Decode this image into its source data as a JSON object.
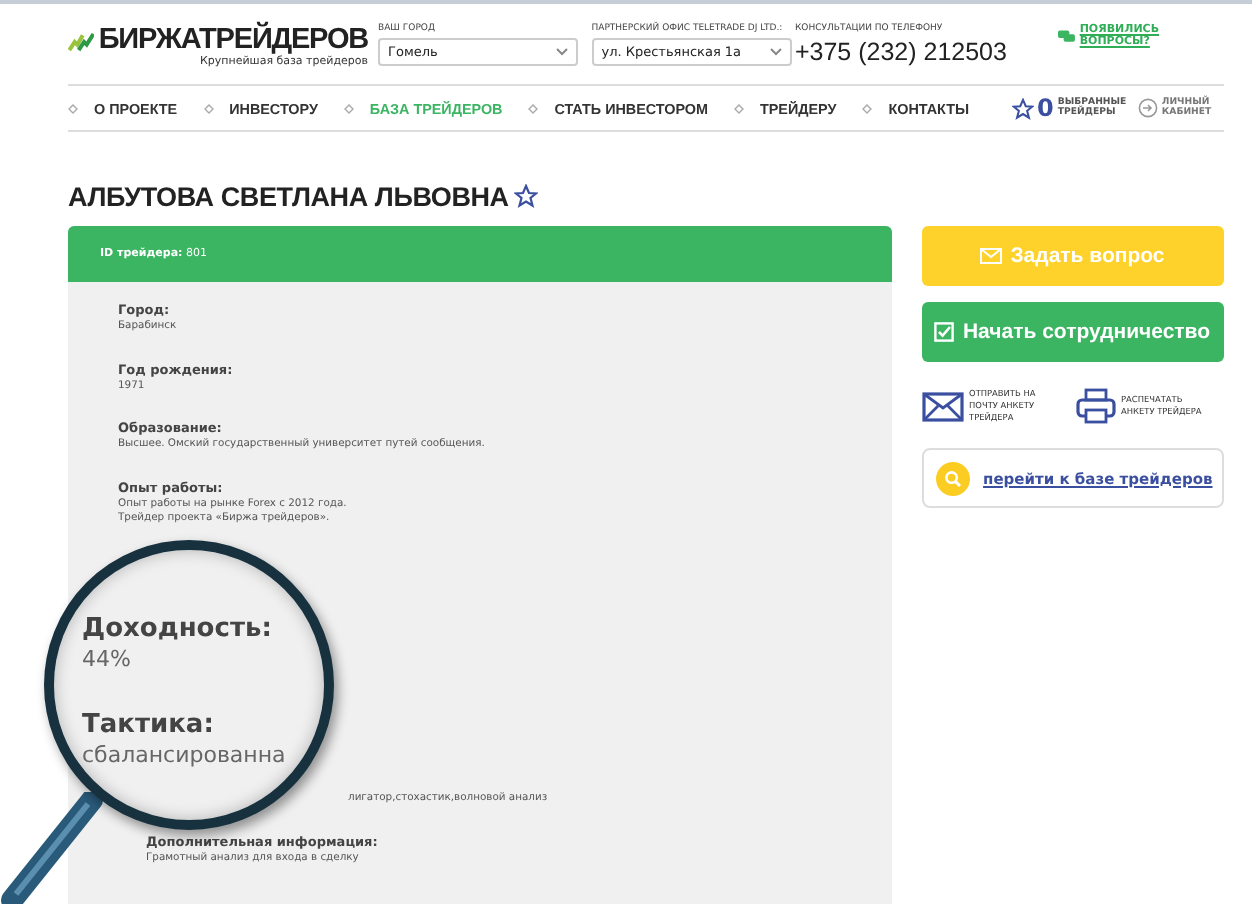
{
  "logo": {
    "title": "БИРЖАТРЕЙДЕРОВ",
    "subtitle": "Крупнейшая база трейдеров"
  },
  "selectors": [
    {
      "label": "ВАШ ГОРОД",
      "value": "Гомель"
    },
    {
      "label": "ПАРТНЕРСКИЙ ОФИС TELETRADE DJ LTD.:",
      "value": "ул. Крестьянская 1а"
    }
  ],
  "phone": {
    "label": "КОНСУЛЬТАЦИИ ПО ТЕЛЕФОНУ",
    "number": "+375 (232) 212503"
  },
  "questions_link": "ПОЯВИЛИСЬ ВОПРОСЫ?",
  "nav": [
    {
      "label": "О ПРОЕКТЕ",
      "selected": false
    },
    {
      "label": "ИНВЕСТОРУ",
      "selected": false
    },
    {
      "label": "БАЗА ТРЕЙДЕРОВ",
      "selected": true
    },
    {
      "label": "СТАТЬ ИНВЕСТОРОМ",
      "selected": false
    },
    {
      "label": "ТРЕЙДЕРУ",
      "selected": false
    },
    {
      "label": "КОНТАКТЫ",
      "selected": false
    }
  ],
  "favorites": {
    "count": "0",
    "label": "ВЫБРАННЫЕ ТРЕЙДЕРЫ"
  },
  "cabinet": "ЛИЧНЫЙ КАБИНЕТ",
  "trader": {
    "name": "АЛБУТОВА СВЕТЛАНА ЛЬВОВНА",
    "id_label": "ID трейдера:",
    "id": "801"
  },
  "fields": [
    {
      "label": "Город:",
      "lines": [
        "Барабинск"
      ]
    },
    {
      "label": "Год рождения:",
      "lines": [
        "1971"
      ]
    },
    {
      "label": "Образование:",
      "lines": [
        "Высшее. Омский государственный университет путей сообщения."
      ]
    },
    {
      "label": "Опыт работы:",
      "lines": [
        "Опыт работы на рынке Forex с 2012 года.",
        "Трейдер проекта «Биржа трейдеров»."
      ]
    }
  ],
  "tactics_tail": "лигатор,стохастик,волновой анализ",
  "extra": {
    "label": "Дополнительная информация:",
    "value": "Грамотный анализ для входа в сделку"
  },
  "magnifier": [
    {
      "label": "Доходность:",
      "value": "44%"
    },
    {
      "label": "Тактика:",
      "value": "сбалансированна"
    }
  ],
  "actions": {
    "ask": "Задать вопрос",
    "cooperate": "Начать сотрудничество",
    "email": "ОТПРАВИТЬ НА ПОЧТУ АНКЕТУ ТРЕЙДЕРА",
    "print": "РАСПЕЧАТАТЬ АНКЕТУ ТРЕЙДЕРА",
    "base_link": "перейти к базе трейдеров"
  }
}
